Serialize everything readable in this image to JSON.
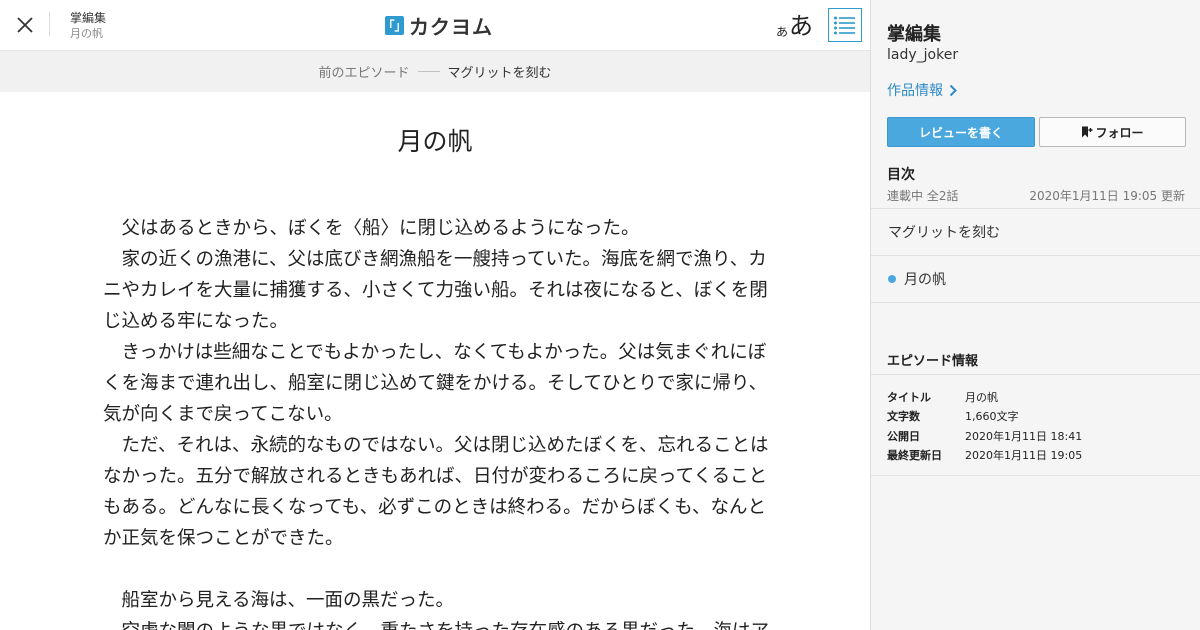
{
  "header": {
    "work_title": "掌編集",
    "episode_title": "月の帆",
    "logo_mark": "「」",
    "logo_text": "カクヨム",
    "font_small": "あ",
    "font_big": "あ"
  },
  "prev_bar": {
    "label": "前のエピソード",
    "title": "マグリットを刻む"
  },
  "episode": {
    "title": "月の帆",
    "lines": [
      "父はあるときから、ぼくを〈船〉に閉じ込めるようになった。",
      "家の近くの漁港に、父は底びき網漁船を一艘持っていた。海底を網で漁り、カ",
      "ニやカレイを大量に捕獲する、小さくて力強い船。それは夜になると、ぼくを閉",
      "じ込める牢になった。",
      "きっかけは些細なことでもよかったし、なくてもよかった。父は気まぐれにぼ",
      "くを海まで連れ出し、船室に閉じ込めて鍵をかける。そしてひとりで家に帰り、",
      "気が向くまで戻ってこない。",
      "ただ、それは、永続的なものではない。父は閉じ込めたぼくを、忘れることは",
      "なかった。五分で解放されるときもあれば、日付が変わるころに戻ってくること",
      "もある。どんなに長くなっても、必ずこのときは終わる。だからぼくも、なんと",
      "か正気を保つことができた。",
      "",
      "船室から見える海は、一面の黒だった。",
      "空虚な闇のような黒ではなく、重たさを持った存在感のある黒だった。海はア"
    ],
    "indented": [
      true,
      true,
      false,
      false,
      true,
      false,
      false,
      true,
      false,
      false,
      false,
      false,
      true,
      true
    ]
  },
  "sidebar": {
    "work_title": "掌編集",
    "author": "lady_joker",
    "info_link": "作品情報",
    "review_button": "レビューを書く",
    "follow_button": "フォロー",
    "toc_heading": "目次",
    "toc_status": "連載中 全2話",
    "toc_updated": "2020年1月11日 19:05 更新",
    "toc_items": [
      {
        "label": "マグリットを刻む",
        "current": false
      },
      {
        "label": "月の帆",
        "current": true
      }
    ],
    "episode_info_heading": "エピソード情報",
    "episode_info": [
      {
        "key": "タイトル",
        "value": "月の帆"
      },
      {
        "key": "文字数",
        "value": "1,660文字"
      },
      {
        "key": "公開日",
        "value": "2020年1月11日 18:41"
      },
      {
        "key": "最終更新日",
        "value": "2020年1月11日 19:05"
      }
    ]
  },
  "colors": {
    "accent": "#2e9ad0",
    "button_blue": "#4aa8de",
    "link": "#2e8ac6"
  },
  "icons": {
    "close": "close-icon",
    "toc": "list-icon",
    "chevron": "chevron-right-icon",
    "bookmark": "bookmark-plus-icon"
  }
}
